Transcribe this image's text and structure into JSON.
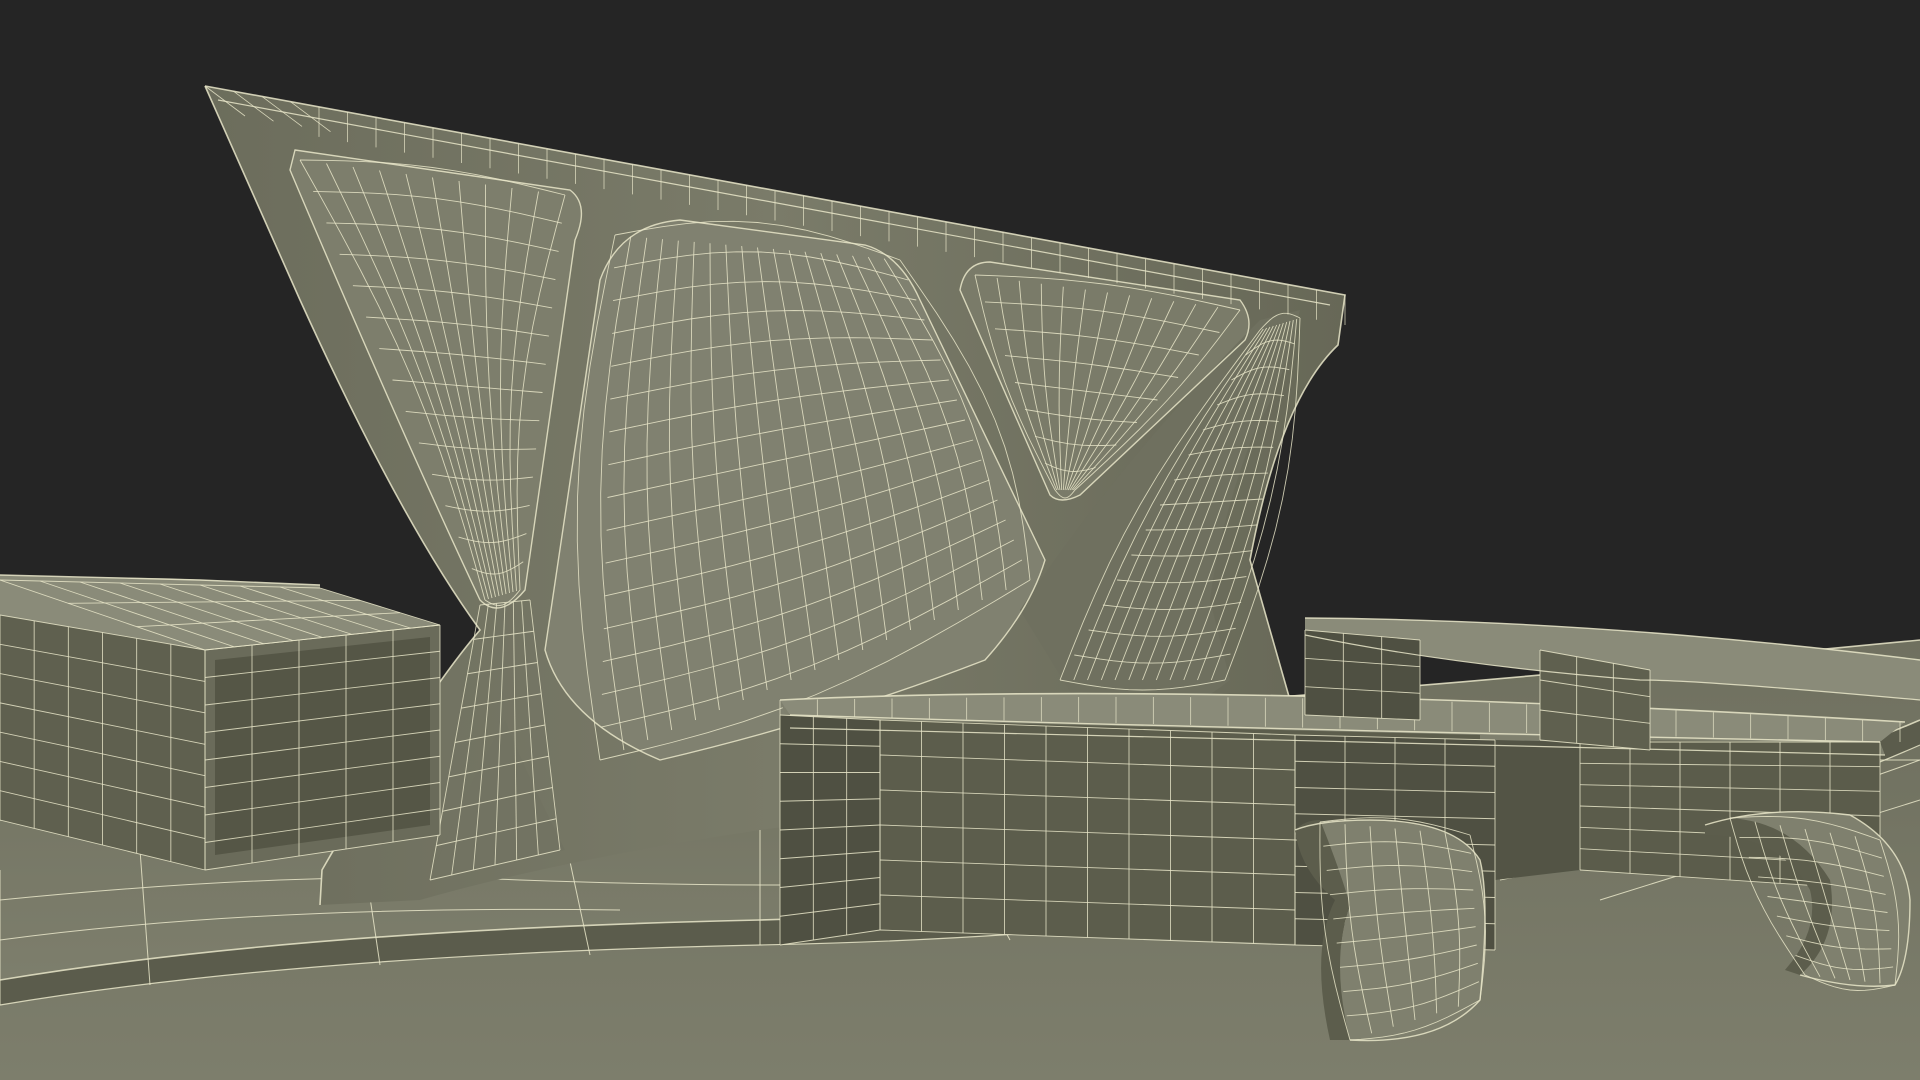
{
  "scene": {
    "subject": "wireframe-3d-model-render",
    "colors": {
      "background": "#252525",
      "surface": "#767766",
      "surface_light": "#8a8b79",
      "surface_dark": "#5f604f",
      "shadow": "#4b4c3f",
      "wire": "#e9e6c9"
    }
  }
}
